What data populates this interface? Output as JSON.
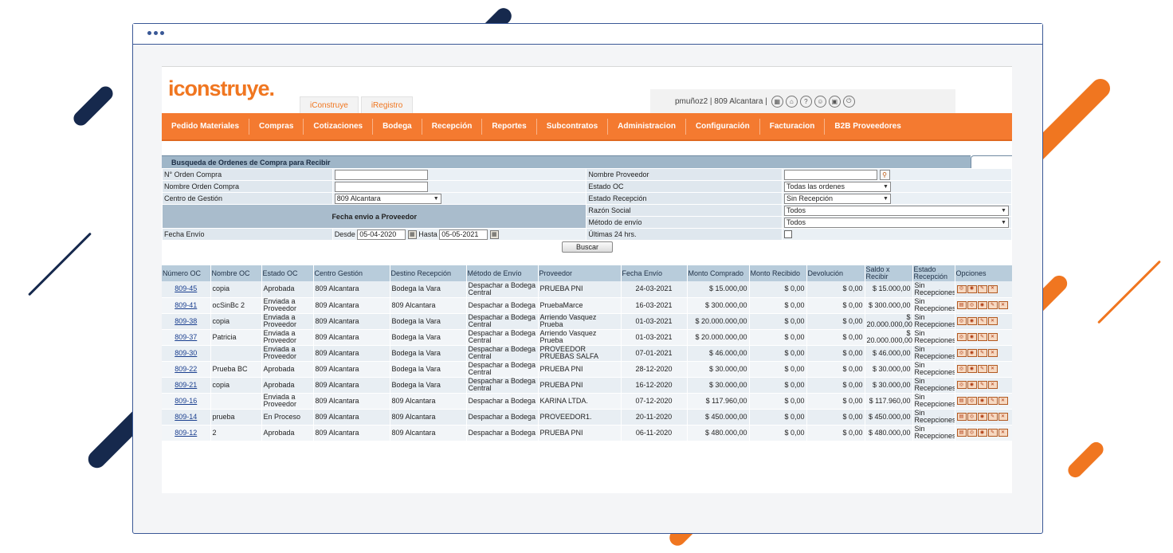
{
  "colors": {
    "brand_orange": "#f47a30",
    "navy": "#16294d",
    "header_blue": "#b8ccdb"
  },
  "app": {
    "logo": "iconstruye."
  },
  "tabs": [
    {
      "label": "iConstruye"
    },
    {
      "label": "iRegistro"
    }
  ],
  "user": {
    "text": "pmuñoz2 | 809 Alcantara |",
    "icons": [
      "building-icon",
      "home-icon",
      "help-icon",
      "user-icon",
      "lock-icon",
      "power-icon"
    ]
  },
  "nav": [
    {
      "label": "Pedido Materiales"
    },
    {
      "label": "Compras"
    },
    {
      "label": "Cotizaciones"
    },
    {
      "label": "Bodega"
    },
    {
      "label": "Recepción"
    },
    {
      "label": "Reportes"
    },
    {
      "label": "Subcontratos"
    },
    {
      "label": "Administracion"
    },
    {
      "label": "Configuración"
    },
    {
      "label": "Facturacion"
    },
    {
      "label": "B2B Proveedores"
    }
  ],
  "search": {
    "title": "Busqueda de Ordenes de Compra para Recibir",
    "orden_compra_label": "N° Orden Compra",
    "orden_compra_value": "",
    "nombre_oc_label": "Nombre Orden Compra",
    "nombre_oc_value": "",
    "centro_label": "Centro de Gestión",
    "centro_value": "809 Alcantara",
    "fecha_section": "Fecha envio a Proveedor",
    "fecha_envio_label": "Fecha Envío",
    "desde_label": "Desde",
    "desde_value": "05-04-2020",
    "hasta_label": "Hasta",
    "hasta_value": "05-05-2021",
    "proveedor_label": "Nombre Proveedor",
    "proveedor_value": "",
    "estado_oc_label": "Estado OC",
    "estado_oc_value": "Todas las ordenes",
    "estado_recepcion_label": "Estado Recepción",
    "estado_recepcion_value": "Sin Recepción",
    "razon_label": "Razón Social",
    "razon_value": "Todos",
    "metodo_label": "Método de envío",
    "metodo_value": "Todos",
    "ultimas_label": "Últimas 24 hrs.",
    "ultimas_checked": false,
    "buscar_label": "Buscar"
  },
  "table": {
    "headers": [
      "Número OC",
      "Nombre OC",
      "Estado OC",
      "Centro Gestión",
      "Destino Recepción",
      "Método de Envío",
      "Proveedor",
      "Fecha Envío",
      "Monto Comprado",
      "Monto Recibido",
      "Devolución",
      "Saldo x Recibir",
      "Estado Recepción",
      "Opciones"
    ],
    "rows": [
      {
        "numero": "809-45",
        "nombre": "copia",
        "estado": "Aprobada",
        "centro": "809 Alcantara",
        "destino": "Bodega la Vara",
        "metodo": "Despachar a Bodega Central",
        "proveedor": "PRUEBA PNI",
        "fecha": "24-03-2021",
        "comprado": "$ 15.000,00",
        "recibido": "$ 0,00",
        "devolucion": "$ 0,00",
        "saldo": "$ 15.000,00",
        "estado_rec": "Sin Recepciones",
        "opciones": 4
      },
      {
        "numero": "809-41",
        "nombre": "ocSinBc 2",
        "estado": "Enviada a Proveedor",
        "centro": "809 Alcantara",
        "destino": "809 Alcantara",
        "metodo": "Despachar a Bodega",
        "proveedor": "PruebaMarce",
        "fecha": "16-03-2021",
        "comprado": "$ 300.000,00",
        "recibido": "$ 0,00",
        "devolucion": "$ 0,00",
        "saldo": "$ 300.000,00",
        "estado_rec": "Sin Recepciones",
        "opciones": 5
      },
      {
        "numero": "809-38",
        "nombre": "copia",
        "estado": "Enviada a Proveedor",
        "centro": "809 Alcantara",
        "destino": "Bodega la Vara",
        "metodo": "Despachar a Bodega Central",
        "proveedor": "Arriendo Vasquez Prueba",
        "fecha": "01-03-2021",
        "comprado": "$ 20.000.000,00",
        "recibido": "$ 0,00",
        "devolucion": "$ 0,00",
        "saldo": "$ 20.000.000,00",
        "estado_rec": "Sin Recepciones",
        "opciones": 4
      },
      {
        "numero": "809-37",
        "nombre": "Patricia",
        "estado": "Enviada a Proveedor",
        "centro": "809 Alcantara",
        "destino": "Bodega la Vara",
        "metodo": "Despachar a Bodega Central",
        "proveedor": "Arriendo Vasquez Prueba",
        "fecha": "01-03-2021",
        "comprado": "$ 20.000.000,00",
        "recibido": "$ 0,00",
        "devolucion": "$ 0,00",
        "saldo": "$ 20.000.000,00",
        "estado_rec": "Sin Recepciones",
        "opciones": 4
      },
      {
        "numero": "809-30",
        "nombre": "",
        "estado": "Enviada a Proveedor",
        "centro": "809 Alcantara",
        "destino": "Bodega la Vara",
        "metodo": "Despachar a Bodega Central",
        "proveedor": "PROVEEDOR PRUEBAS SALFA",
        "fecha": "07-01-2021",
        "comprado": "$ 46.000,00",
        "recibido": "$ 0,00",
        "devolucion": "$ 0,00",
        "saldo": "$ 46.000,00",
        "estado_rec": "Sin Recepciones",
        "opciones": 4
      },
      {
        "numero": "809-22",
        "nombre": "Prueba BC",
        "estado": "Aprobada",
        "centro": "809 Alcantara",
        "destino": "Bodega la Vara",
        "metodo": "Despachar a Bodega Central",
        "proveedor": "PRUEBA PNI",
        "fecha": "28-12-2020",
        "comprado": "$ 30.000,00",
        "recibido": "$ 0,00",
        "devolucion": "$ 0,00",
        "saldo": "$ 30.000,00",
        "estado_rec": "Sin Recepciones",
        "opciones": 4
      },
      {
        "numero": "809-21",
        "nombre": "copia",
        "estado": "Aprobada",
        "centro": "809 Alcantara",
        "destino": "Bodega la Vara",
        "metodo": "Despachar a Bodega Central",
        "proveedor": "PRUEBA PNI",
        "fecha": "16-12-2020",
        "comprado": "$ 30.000,00",
        "recibido": "$ 0,00",
        "devolucion": "$ 0,00",
        "saldo": "$ 30.000,00",
        "estado_rec": "Sin Recepciones",
        "opciones": 4
      },
      {
        "numero": "809-16",
        "nombre": "",
        "estado": "Enviada a Proveedor",
        "centro": "809 Alcantara",
        "destino": "809 Alcantara",
        "metodo": "Despachar a Bodega",
        "proveedor": "KARINA LTDA.",
        "fecha": "07-12-2020",
        "comprado": "$ 117.960,00",
        "recibido": "$ 0,00",
        "devolucion": "$ 0,00",
        "saldo": "$ 117.960,00",
        "estado_rec": "Sin Recepciones",
        "opciones": 5
      },
      {
        "numero": "809-14",
        "nombre": "prueba",
        "estado": "En Proceso",
        "centro": "809 Alcantara",
        "destino": "809 Alcantara",
        "metodo": "Despachar a Bodega",
        "proveedor": "PROVEEDOR1.",
        "fecha": "20-11-2020",
        "comprado": "$ 450.000,00",
        "recibido": "$ 0,00",
        "devolucion": "$ 0,00",
        "saldo": "$ 450.000,00",
        "estado_rec": "Sin Recepciones",
        "opciones": 5
      },
      {
        "numero": "809-12",
        "nombre": "2",
        "estado": "Aprobada",
        "centro": "809 Alcantara",
        "destino": "809 Alcantara",
        "metodo": "Despachar a Bodega",
        "proveedor": "PRUEBA PNI",
        "fecha": "06-11-2020",
        "comprado": "$ 480.000,00",
        "recibido": "$ 0,00",
        "devolucion": "$ 0,00",
        "saldo": "$ 480.000,00",
        "estado_rec": "Sin Recepciones",
        "opciones": 5
      }
    ]
  }
}
